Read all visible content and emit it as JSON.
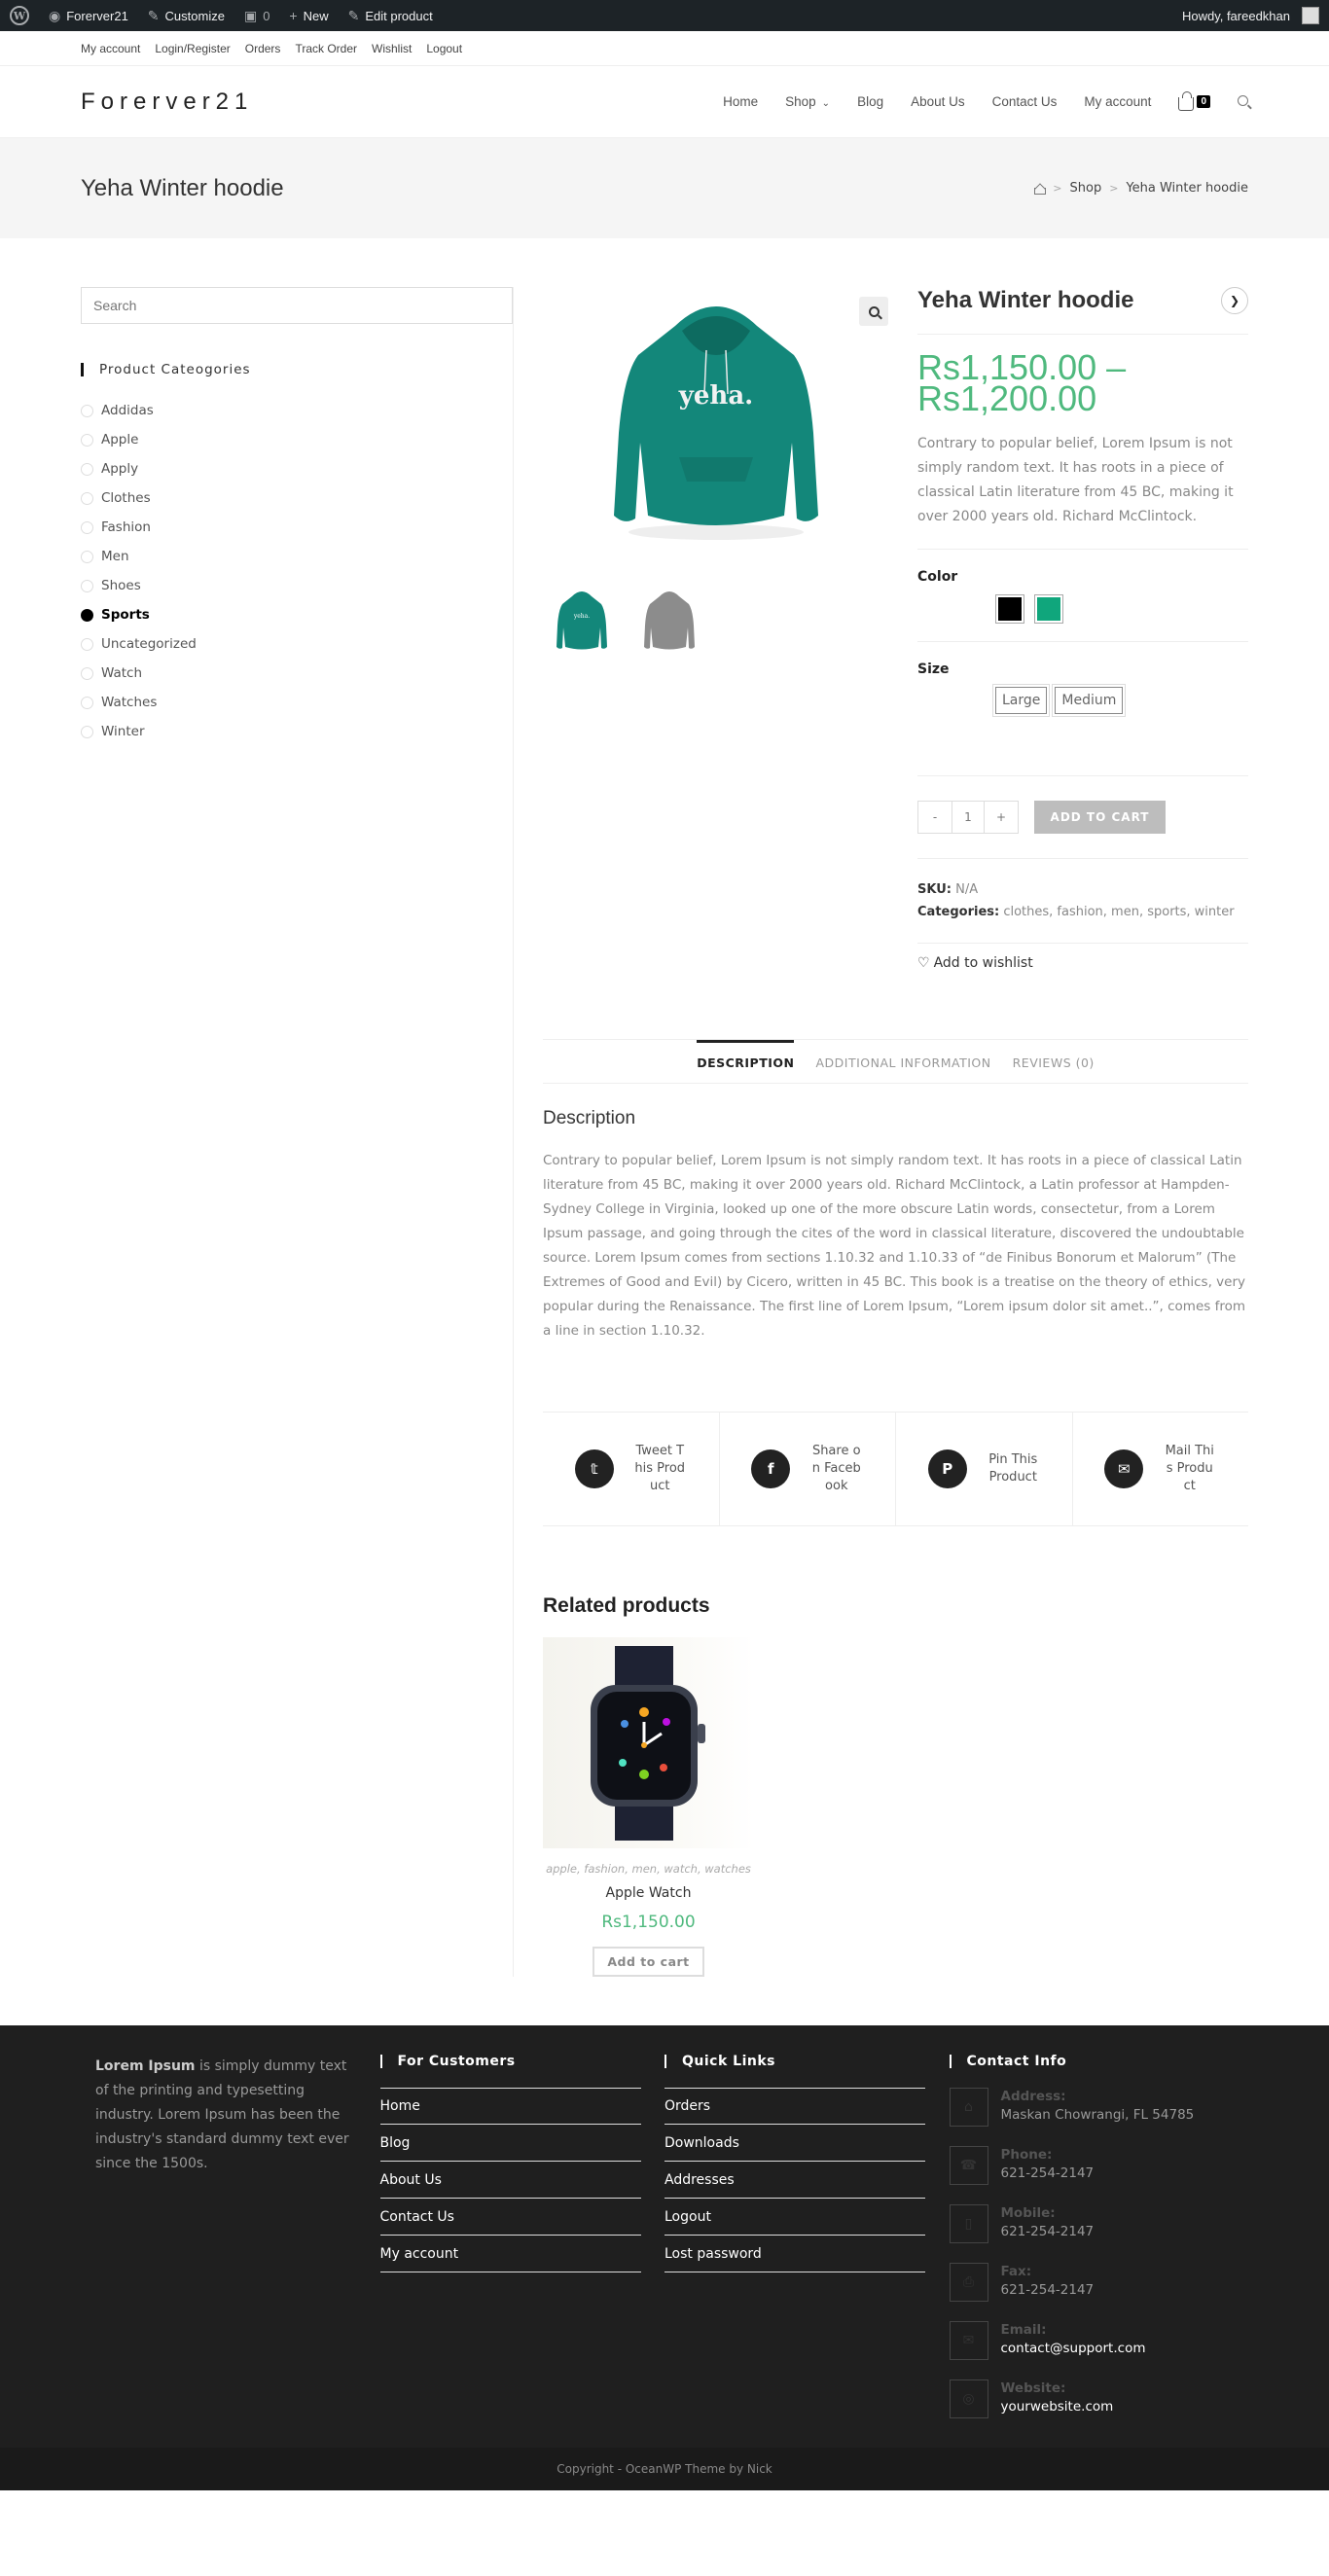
{
  "admin_bar": {
    "site_name": "Forerver21",
    "customize": "Customize",
    "comments_count": "0",
    "new_label": "New",
    "edit_label": "Edit product",
    "howdy": "Howdy, fareedkhan"
  },
  "top_bar": {
    "links": [
      "My account",
      "Login/Register",
      "Orders",
      "Track Order",
      "Wishlist",
      "Logout"
    ]
  },
  "header": {
    "logo": "Forerver21",
    "nav": [
      "Home",
      "Shop",
      "Blog",
      "About Us",
      "Contact Us",
      "My account"
    ],
    "cart_count": "0"
  },
  "page_header": {
    "title": "Yeha Winter hoodie",
    "breadcrumb": [
      "Shop",
      "Yeha Winter hoodie"
    ]
  },
  "sidebar": {
    "search_placeholder": "Search",
    "widget_title": "Product Cateogories",
    "categories": [
      "Addidas",
      "Apple",
      "Apply",
      "Clothes",
      "Fashion",
      "Men",
      "Shoes",
      "Sports",
      "Uncategorized",
      "Watch",
      "Watches",
      "Winter"
    ],
    "active_category": "Sports"
  },
  "product": {
    "title": "Yeha Winter hoodie",
    "price_line1": "Rs1,150.00 –",
    "price_line2": "Rs1,200.00",
    "image_text": "yeha.",
    "short_description": "Contrary to popular belief, Lorem Ipsum is not simply random text. It has roots in a piece of classical Latin literature from 45 BC, making it over 2000 years old. Richard McClintock.",
    "color_label": "Color",
    "colors": [
      "#000000",
      "#10a67c"
    ],
    "size_label": "Size",
    "sizes": [
      "Large",
      "Medium"
    ],
    "qty_minus": "-",
    "quantity": "1",
    "qty_plus": "+",
    "add_to_cart": "ADD TO CART",
    "sku_label": "SKU:",
    "sku": "N/A",
    "categories_label": "Categories:",
    "categories": "clothes, fashion, men, sports, winter",
    "wishlist": "Add to wishlist"
  },
  "tabs": [
    "DESCRIPTION",
    "ADDITIONAL INFORMATION",
    "REVIEWS (0)"
  ],
  "description": {
    "title": "Description",
    "text": "Contrary to popular belief, Lorem Ipsum is not simply random text. It has roots in a piece of classical Latin literature from 45 BC, making it over 2000 years old. Richard McClintock, a Latin professor at Hampden-Sydney College in Virginia, looked up one of the more obscure Latin words, consectetur, from a Lorem Ipsum passage, and going through the cites of the word in classical literature, discovered the undoubtable source. Lorem Ipsum comes from sections 1.10.32 and 1.10.33 of “de Finibus Bonorum et Malorum” (The Extremes of Good and Evil) by Cicero, written in 45 BC. This book is a treatise on the theory of ethics, very popular during the Renaissance. The first line of Lorem Ipsum, “Lorem ipsum dolor sit amet..”, comes from a line in section 1.10.32."
  },
  "share": [
    {
      "icon": "twitter-icon",
      "label": "Tweet This Product"
    },
    {
      "icon": "facebook-icon",
      "label": "Share on Facebook"
    },
    {
      "icon": "pinterest-icon",
      "label": "Pin This Product"
    },
    {
      "icon": "mail-icon",
      "label": "Mail This Product"
    }
  ],
  "related": {
    "title": "Related products",
    "items": [
      {
        "categories": "apple, fashion, men, watch, watches",
        "name": "Apple Watch",
        "price": "Rs1,150.00",
        "button": "Add to cart"
      }
    ]
  },
  "footer": {
    "about_bold": "Lorem Ipsum",
    "about_rest": " is simply dummy text of the printing and typesetting industry. Lorem Ipsum has been the industry's standard dummy text ever since the 1500s.",
    "customers_title": "For Customers",
    "customers_links": [
      "Home",
      "Blog",
      "About Us",
      "Contact Us",
      "My account"
    ],
    "quick_title": "Quick Links",
    "quick_links": [
      "Orders",
      "Downloads",
      "Addresses",
      "Logout",
      "Lost password"
    ],
    "contact_title": "Contact Info",
    "contact": [
      {
        "label": "Address:",
        "value": "Maskan Chowrangi, FL 54785"
      },
      {
        "label": "Phone:",
        "value": "621-254-2147"
      },
      {
        "label": "Mobile:",
        "value": "621-254-2147"
      },
      {
        "label": "Fax:",
        "value": "621-254-2147"
      },
      {
        "label": "Email:",
        "value": "contact@support.com"
      },
      {
        "label": "Website:",
        "value": "yourwebsite.com"
      }
    ],
    "copyright": "Copyright - OceanWP Theme by Nick"
  },
  "colors": {
    "price_green": "#4fb97e",
    "admin_bar": "#1d2327",
    "footer_bg": "#1f1f1f"
  }
}
